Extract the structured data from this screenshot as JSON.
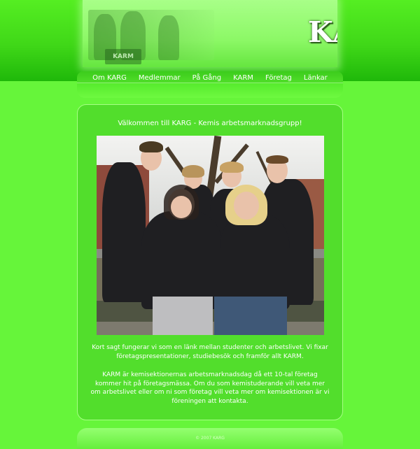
{
  "banner": {
    "logo_text": "KARG",
    "sign_text": "KARM"
  },
  "nav": {
    "items": [
      {
        "label": "Om KARG"
      },
      {
        "label": "Medlemmar"
      },
      {
        "label": "På Gång"
      },
      {
        "label": "KARM"
      },
      {
        "label": "Företag"
      },
      {
        "label": "Länkar"
      }
    ]
  },
  "content": {
    "welcome": "Välkommen till KARG - Kemis arbetsmarknadsgrupp!",
    "paragraph1_line1": "Kort sagt fungerar vi som en länk mellan studenter och arbetslivet. Vi fixar",
    "paragraph1_line2": "företagspresentationer, studiebesök och framför allt KARM.",
    "paragraph2_line1": "KARM är kemisektionernas arbetsmarknadsdag då ett 10-tal företag",
    "paragraph2_line2": "kommer hit på företagsmässa. Om du som kemistuderande vill veta mer",
    "paragraph2_line3": "om arbetslivet eller om ni som företag vill veta mer om kemisektionen är vi",
    "paragraph2_line4": "föreningen att kontakta."
  },
  "footer": {
    "copyright": "© 2007 KARG"
  },
  "colors": {
    "page_background": "#66f53a",
    "header_band": "#40d818",
    "panel": "#52de2c",
    "text": "#ffffff"
  }
}
